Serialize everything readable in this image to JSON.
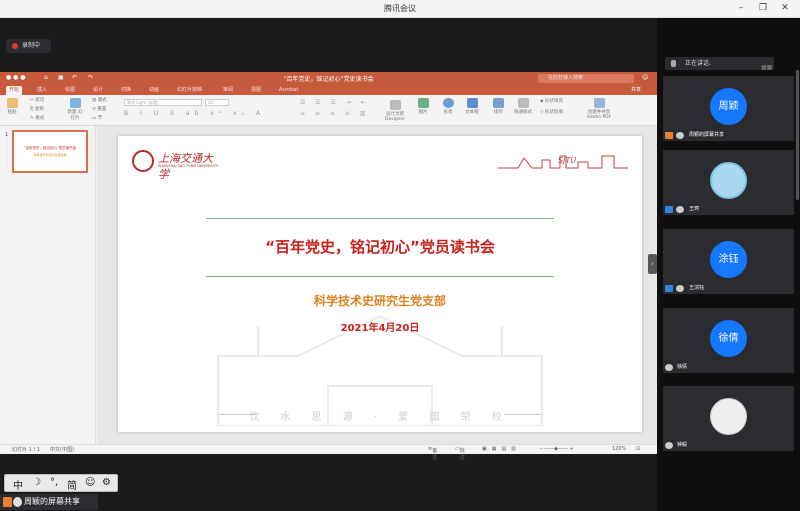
{
  "app": {
    "title": "腾讯会议",
    "record_label": "录制中"
  },
  "ppt": {
    "doc_title": "“百年党史，铭记初心”党史读书会",
    "search_placeholder": "在此处输入搜索",
    "share_label": "共享",
    "tabs": [
      "开始",
      "插入",
      "绘图",
      "设计",
      "切换",
      "动画",
      "幻灯片放映",
      "审阅",
      "视图",
      "Acrobat"
    ],
    "ribbon": {
      "paste": "粘贴",
      "cut": "剪切",
      "copy": "复制",
      "format": "格式",
      "new_slide": "新建\n幻灯片",
      "layout": "版式",
      "reset": "重置",
      "section": "节",
      "font_name": "等线 Light (标题)",
      "font_size": "32",
      "pictures": "图片",
      "shapes": "形状",
      "textbox": "文本框",
      "arrange": "排列",
      "quick_styles": "快速样式",
      "shape_fill": "形状填充",
      "shape_outline": "形状轮廓",
      "designer": "设计灵感\nDesigner",
      "create_pdf": "创建并共享\nAdobe PDF"
    },
    "slide_number": "1",
    "slide": {
      "logo_text": "上海交通大学",
      "logo_sub": "SHANGHAI JIAO TONG UNIVERSITY",
      "watermark": "SJTU",
      "title": "“百年党史，铭记初心”党员读书会",
      "department": "科学技术史研究生党支部",
      "date": "2021年4月20日",
      "motto": "饮 水 思 源 · 爱 国 荣 校"
    },
    "status": {
      "slide_info": "幻灯片 1 / 1",
      "language": "中文(中国)",
      "notes": "备注",
      "comments": "批注",
      "zoom": "120%"
    }
  },
  "ime": {
    "items": [
      "中",
      "☽",
      "°,",
      "简",
      "☺",
      "⚙"
    ]
  },
  "sharer_label": "周颖的屏幕共享",
  "panel": {
    "speaking_label": "正在讲话:",
    "participants": [
      {
        "avatar": "周颖",
        "name": "周颖的屏幕共享",
        "color": "#1677ff"
      },
      {
        "avatar": "",
        "name": "王珂",
        "color": "#a9d8ef"
      },
      {
        "avatar": "涂钰",
        "name": "王淙钰",
        "color": "#1677ff"
      },
      {
        "avatar": "徐倩",
        "name": "徐倩",
        "color": "#1677ff"
      },
      {
        "avatar": "",
        "name": "钟毅",
        "color": "#e6e6e6"
      }
    ]
  }
}
